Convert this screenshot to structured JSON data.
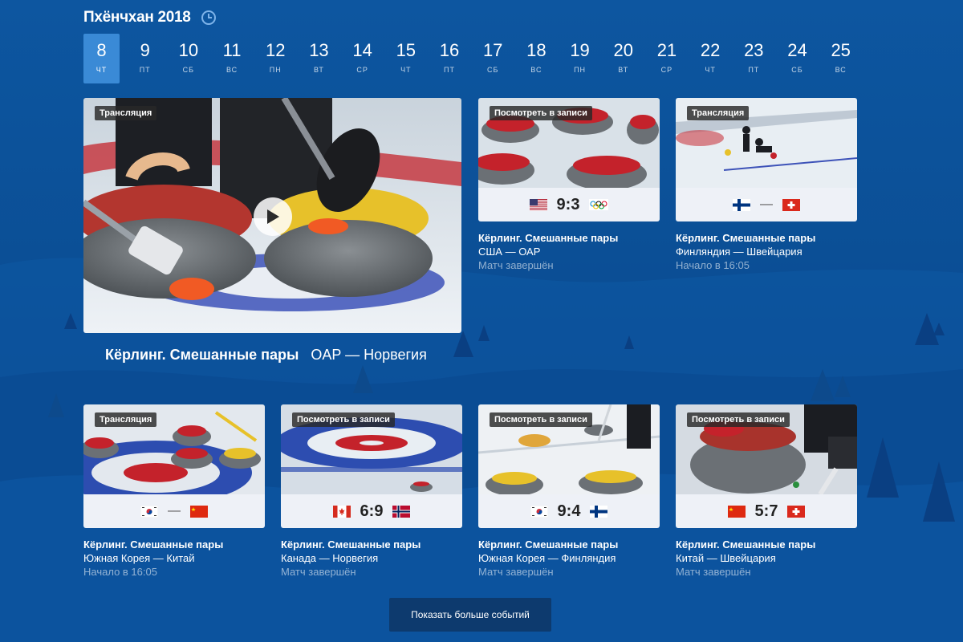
{
  "header": {
    "title": "Пхёнчхан 2018",
    "icon": "clock-icon"
  },
  "days": [
    {
      "num": "8",
      "dow": "ЧТ",
      "active": true
    },
    {
      "num": "9",
      "dow": "ПТ"
    },
    {
      "num": "10",
      "dow": "СБ"
    },
    {
      "num": "11",
      "dow": "ВС"
    },
    {
      "num": "12",
      "dow": "ПН"
    },
    {
      "num": "13",
      "dow": "ВТ"
    },
    {
      "num": "14",
      "dow": "СР"
    },
    {
      "num": "15",
      "dow": "ЧТ"
    },
    {
      "num": "16",
      "dow": "ПТ"
    },
    {
      "num": "17",
      "dow": "СБ"
    },
    {
      "num": "18",
      "dow": "ВС"
    },
    {
      "num": "19",
      "dow": "ПН"
    },
    {
      "num": "20",
      "dow": "ВТ"
    },
    {
      "num": "21",
      "dow": "СР"
    },
    {
      "num": "22",
      "dow": "ЧТ"
    },
    {
      "num": "23",
      "dow": "ПТ"
    },
    {
      "num": "24",
      "dow": "СБ"
    },
    {
      "num": "25",
      "dow": "ВС"
    }
  ],
  "featured": {
    "badge": "Трансляция",
    "title_sport": "Кёрлинг. Смешанные пары",
    "title_match": "OAP — Норвегия"
  },
  "cards": [
    {
      "badge": "Посмотреть в записи",
      "left_flag": "usa",
      "score": "9:3",
      "right_flag": "olympic",
      "sport": "Кёрлинг. Смешанные пары",
      "match": "США — ОАР",
      "status": "Матч завершён"
    },
    {
      "badge": "Трансляция",
      "left_flag": "finland",
      "score": "—",
      "right_flag": "switzerland",
      "sport": "Кёрлинг. Смешанные пары",
      "match": "Финляндия — Швейцария",
      "status": "Начало в 16:05"
    },
    {
      "badge": "Трансляция",
      "left_flag": "korea",
      "score": "—",
      "right_flag": "china",
      "sport": "Кёрлинг. Смешанные пары",
      "match": "Южная Корея — Китай",
      "status": "Начало в 16:05"
    },
    {
      "badge": "Посмотреть в записи",
      "left_flag": "canada",
      "score": "6:9",
      "right_flag": "norway",
      "sport": "Кёрлинг. Смешанные пары",
      "match": "Канада — Норвегия",
      "status": "Матч завершён"
    },
    {
      "badge": "Посмотреть в записи",
      "left_flag": "korea",
      "score": "9:4",
      "right_flag": "finland",
      "sport": "Кёрлинг. Смешанные пары",
      "match": "Южная Корея — Финляндия",
      "status": "Матч завершён"
    },
    {
      "badge": "Посмотреть в записи",
      "left_flag": "china",
      "score": "5:7",
      "right_flag": "switzerland",
      "sport": "Кёрлинг. Смешанные пары",
      "match": "Китай — Швейцария",
      "status": "Матч завершён"
    }
  ],
  "more_button": "Показать больше событий",
  "colors": {
    "accent": "#3a8ad6",
    "background": "#0b4f96",
    "button": "#0d3a6e",
    "scorebar": "#eef1f7"
  }
}
